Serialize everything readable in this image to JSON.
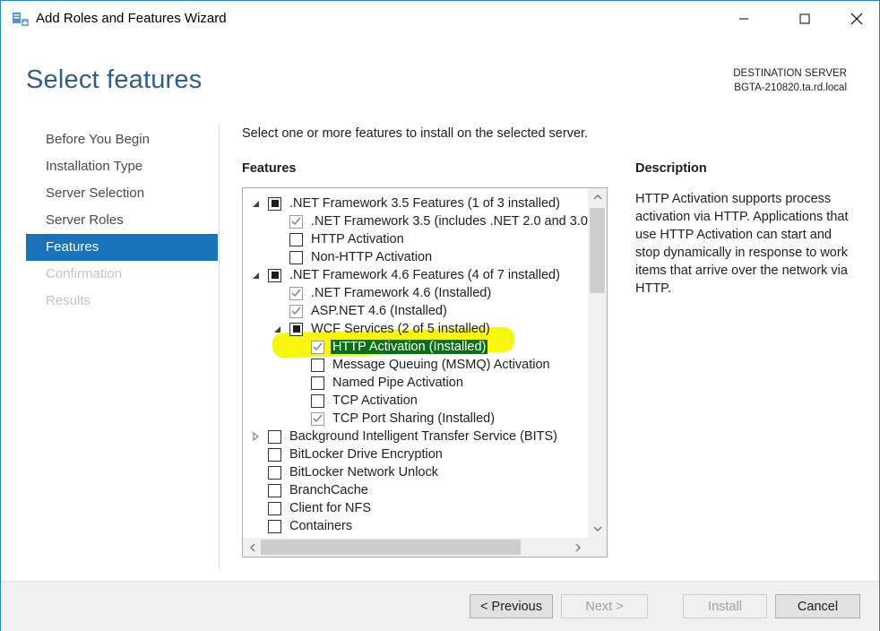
{
  "window": {
    "title": "Add Roles and Features Wizard",
    "page_title": "Select features",
    "destination_label": "DESTINATION SERVER",
    "destination_server": "BGTA-210820.ta.rd.local"
  },
  "nav": {
    "items": [
      {
        "label": "Before You Begin",
        "state": "normal"
      },
      {
        "label": "Installation Type",
        "state": "normal"
      },
      {
        "label": "Server Selection",
        "state": "normal"
      },
      {
        "label": "Server Roles",
        "state": "normal"
      },
      {
        "label": "Features",
        "state": "active"
      },
      {
        "label": "Confirmation",
        "state": "disabled"
      },
      {
        "label": "Results",
        "state": "disabled"
      }
    ]
  },
  "main": {
    "instruction": "Select one or more features to install on the selected server.",
    "features_heading": "Features",
    "description_heading": "Description",
    "description": "HTTP Activation supports process activation via HTTP. Applications that use HTTP Activation can start and stop dynamically in response to work items that arrive over the network via HTTP."
  },
  "features": {
    "items": [
      {
        "label": ".NET Framework 3.5 Features (1 of 3 installed)",
        "state": "indeterminate",
        "expander": "expanded"
      },
      {
        "label": ".NET Framework 3.5 (includes .NET 2.0 and 3.0)",
        "state": "checked",
        "expander": "none"
      },
      {
        "label": "HTTP Activation",
        "state": "unchecked",
        "expander": "none"
      },
      {
        "label": "Non-HTTP Activation",
        "state": "unchecked",
        "expander": "none"
      },
      {
        "label": ".NET Framework 4.6 Features (4 of 7 installed)",
        "state": "indeterminate",
        "expander": "expanded"
      },
      {
        "label": ".NET Framework 4.6 (Installed)",
        "state": "checked",
        "expander": "none"
      },
      {
        "label": "ASP.NET 4.6 (Installed)",
        "state": "checked",
        "expander": "none"
      },
      {
        "label": "WCF Services (2 of 5 installed)",
        "state": "indeterminate",
        "expander": "expanded"
      },
      {
        "label": "HTTP Activation (Installed)",
        "state": "checked",
        "expander": "none",
        "selected": true
      },
      {
        "label": "Message Queuing (MSMQ) Activation",
        "state": "unchecked",
        "expander": "none"
      },
      {
        "label": "Named Pipe Activation",
        "state": "unchecked",
        "expander": "none"
      },
      {
        "label": "TCP Activation",
        "state": "unchecked",
        "expander": "none"
      },
      {
        "label": "TCP Port Sharing (Installed)",
        "state": "checked",
        "expander": "none"
      },
      {
        "label": "Background Intelligent Transfer Service (BITS)",
        "state": "unchecked",
        "expander": "collapsed"
      },
      {
        "label": "BitLocker Drive Encryption",
        "state": "unchecked",
        "expander": "none"
      },
      {
        "label": "BitLocker Network Unlock",
        "state": "unchecked",
        "expander": "none"
      },
      {
        "label": "BranchCache",
        "state": "unchecked",
        "expander": "none"
      },
      {
        "label": "Client for NFS",
        "state": "unchecked",
        "expander": "none"
      },
      {
        "label": "Containers",
        "state": "unchecked",
        "expander": "none"
      }
    ]
  },
  "footer": {
    "previous_label": "< Previous",
    "next_label": "Next >",
    "install_label": "Install",
    "cancel_label": "Cancel"
  },
  "colors": {
    "accent": "#1a72bb",
    "title_blue": "#2f5f87",
    "selection": "#0a6f15",
    "highlighter": "#f7f700"
  }
}
